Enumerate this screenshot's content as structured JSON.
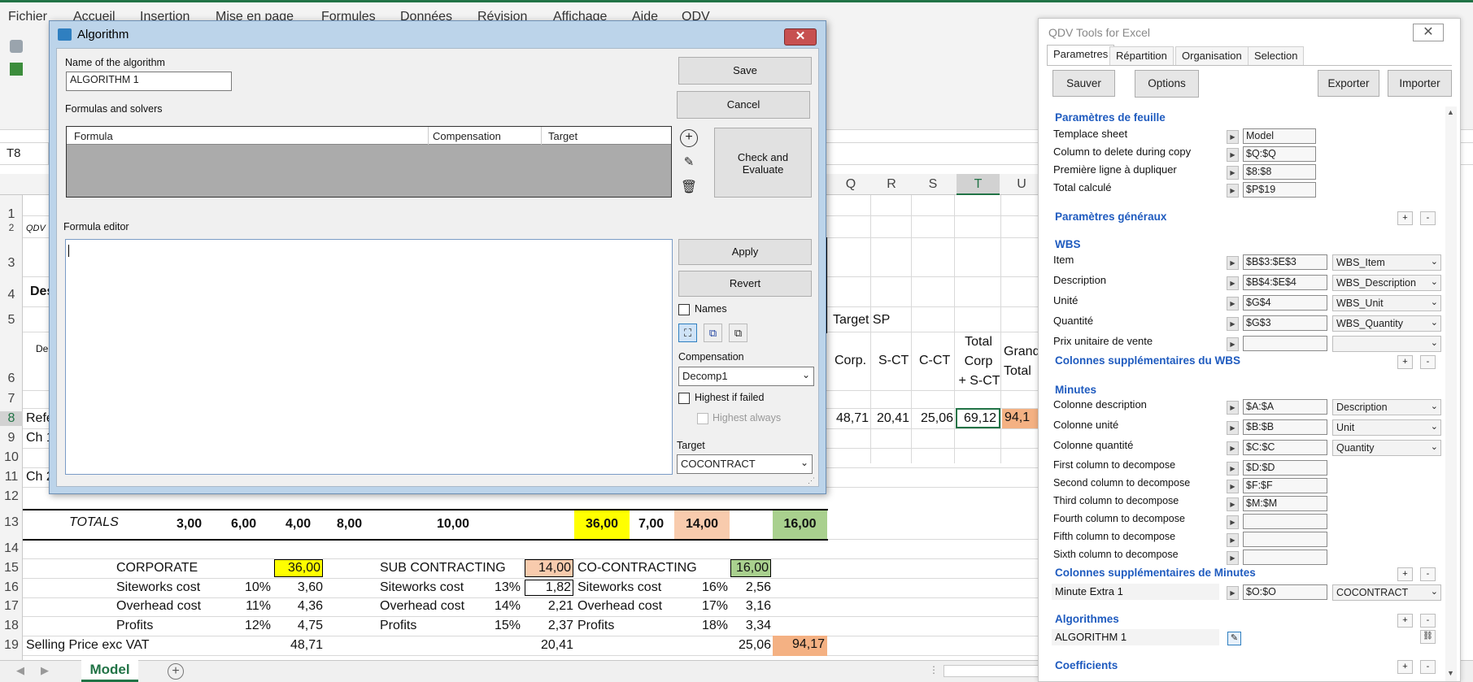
{
  "excel": {
    "menu": [
      "Fichier",
      "Accueil",
      "Insertion",
      "Mise en page",
      "Formules",
      "Données",
      "Révision",
      "Affichage",
      "Aide",
      "QDV"
    ],
    "name_box": "T8",
    "columns": [
      "Q",
      "R",
      "S",
      "T",
      "U"
    ],
    "rows": [
      "1",
      "2",
      "3",
      "4",
      "5",
      "6",
      "7",
      "8",
      "9",
      "10",
      "11",
      "12",
      "13",
      "14",
      "15",
      "16",
      "17",
      "18",
      "19"
    ],
    "partial": {
      "r2": "QDV",
      "r4": "Des",
      "r6": "De",
      "r8": "Refe",
      "r9": "Ch 1",
      "r11": "Ch 2"
    },
    "target_sp": "Target SP",
    "hdr": {
      "corp": "Corp.",
      "sct": "S-CT",
      "cct": "C-CT",
      "total_l1": "Total",
      "total_l2": "Corp",
      "total_l3": "+ S-CT",
      "grand_l1": "Grand",
      "grand_l2": "Total"
    },
    "row8": {
      "corp": "48,71",
      "sct": "20,41",
      "cct": "25,06",
      "total": "69,12",
      "grand": "94,1"
    },
    "totals": {
      "label": "TOTALS",
      "v1": "3,00",
      "v2": "6,00",
      "v3": "4,00",
      "v4": "8,00",
      "v5": "10,00",
      "v6": "36,00",
      "v7": "7,00",
      "v8": "14,00",
      "v9": "16,00"
    },
    "summary": {
      "corporate": "CORPORATE",
      "corporate_total": "36,00",
      "sub": "SUB CONTRACTING",
      "sub_total": "14,00",
      "co": "CO-CONTRACTING",
      "co_total": "16,00",
      "siteworks": "Siteworks cost",
      "overhead": "Overhead cost",
      "profits": "Profits",
      "c_site_pct": "10%",
      "c_site": "3,60",
      "c_over_pct": "11%",
      "c_over": "4,36",
      "c_prof_pct": "12%",
      "c_prof": "4,75",
      "s_site_pct": "13%",
      "s_site": "1,82",
      "s_over_pct": "14%",
      "s_over": "2,21",
      "s_prof_pct": "15%",
      "s_prof": "2,37",
      "o_site_pct": "16%",
      "o_site": "2,56",
      "o_over_pct": "17%",
      "o_over": "3,16",
      "o_prof_pct": "18%",
      "o_prof": "3,34",
      "selling": "Selling Price  exc VAT",
      "sell_c": "48,71",
      "sell_s": "20,41",
      "sell_o": "25,06",
      "sell_total": "94,17"
    },
    "sheet_tab": "Model"
  },
  "dialog": {
    "title": "Algorithm",
    "name_label": "Name of the algorithm",
    "name_value": "ALGORITHM 1",
    "formulas_label": "Formulas and solvers",
    "table_headers": [
      "Formula",
      "Compensation",
      "Target"
    ],
    "editor_label": "Formula editor",
    "save": "Save",
    "cancel": "Cancel",
    "check_l1": "Check and",
    "check_l2": "Evaluate",
    "apply": "Apply",
    "revert": "Revert",
    "names": "Names",
    "compensation_label": "Compensation",
    "compensation_value": "Decomp1",
    "highest_if_failed": "Highest if failed",
    "highest_always": "Highest always",
    "target_label": "Target",
    "target_value": "COCONTRACT"
  },
  "panel": {
    "title": "QDV Tools for Excel",
    "tabs": [
      "Parametres",
      "Répartition",
      "Organisation",
      "Selection"
    ],
    "buttons": {
      "save": "Sauver",
      "options": "Options",
      "export": "Exporter",
      "import": "Importer"
    },
    "sheet_params": "Paramètres de feuille",
    "template_sheet": "Templace sheet",
    "template_value": "Model",
    "col_delete": "Column to delete during copy",
    "col_delete_value": "$Q:$Q",
    "first_line": "Première ligne à dupliquer",
    "first_line_value": "$8:$8",
    "total_calc": "Total calculé",
    "total_calc_value": "$P$19",
    "general_params": "Paramètres généraux",
    "wbs": "WBS",
    "item": "Item",
    "item_value": "$B$3:$E$3",
    "item_sel": "WBS_Item",
    "description": "Description",
    "description_value": "$B$4:$E$4",
    "description_sel": "WBS_Description",
    "unit": "Unité",
    "unit_value": "$G$4",
    "unit_sel": "WBS_Unit",
    "quantity": "Quantité",
    "quantity_value": "$G$3",
    "quantity_sel": "WBS_Quantity",
    "unit_price": "Prix unitaire de vente",
    "wbs_extra": "Colonnes supplémentaires du WBS",
    "minutes": "Minutes",
    "col_desc": "Colonne description",
    "col_desc_value": "$A:$A",
    "col_desc_sel": "Description",
    "col_unit": "Colonne unité",
    "col_unit_value": "$B:$B",
    "col_unit_sel": "Unit",
    "col_qty": "Colonne quantité",
    "col_qty_value": "$C:$C",
    "col_qty_sel": "Quantity",
    "first_dec": "First column to decompose",
    "first_dec_value": "$D:$D",
    "second_dec": "Second column to decompose",
    "second_dec_value": "$F:$F",
    "third_dec": "Third column to decompose",
    "third_dec_value": "$M:$M",
    "fourth_dec": "Fourth column to decompose",
    "fifth_dec": "Fifth column to decompose",
    "sixth_dec": "Sixth column to decompose",
    "minutes_extra": "Colonnes supplémentaires de Minutes",
    "minute_extra1": "Minute Extra 1",
    "minute_extra1_value": "$O:$O",
    "minute_extra1_sel": "COCONTRACT",
    "algorithms": "Algorithmes",
    "algorithm1": "ALGORITHM 1",
    "coefficients": "Coefficients"
  }
}
